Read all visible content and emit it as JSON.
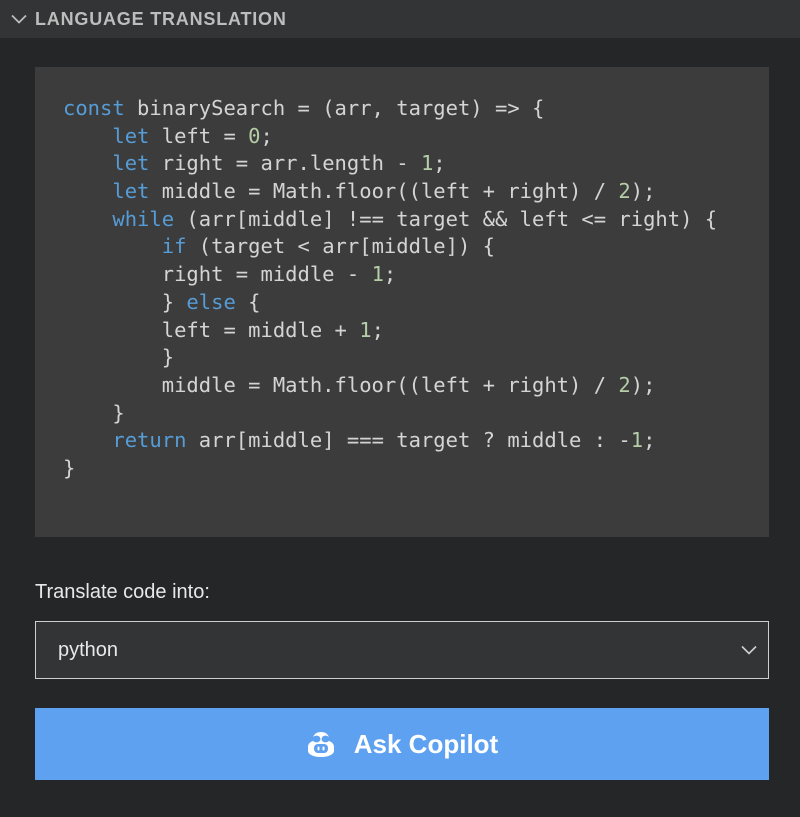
{
  "header": {
    "title": "LANGUAGE TRANSLATION",
    "icon": "chevron-down-icon"
  },
  "code": {
    "lines": [
      [
        [
          "kw",
          "const"
        ],
        [
          "p",
          " binarySearch = (arr, target) => {"
        ]
      ],
      [
        [
          "p",
          "    "
        ],
        [
          "kw",
          "let"
        ],
        [
          "p",
          " left = "
        ],
        [
          "num",
          "0"
        ],
        [
          "p",
          ";"
        ]
      ],
      [
        [
          "p",
          "    "
        ],
        [
          "kw",
          "let"
        ],
        [
          "p",
          " right = arr.length - "
        ],
        [
          "num",
          "1"
        ],
        [
          "p",
          ";"
        ]
      ],
      [
        [
          "p",
          "    "
        ],
        [
          "kw",
          "let"
        ],
        [
          "p",
          " middle = Math.floor((left + right) / "
        ],
        [
          "num",
          "2"
        ],
        [
          "p",
          ");"
        ]
      ],
      [
        [
          "p",
          "    "
        ],
        [
          "kw",
          "while"
        ],
        [
          "p",
          " (arr[middle] !== target && left <= right) {"
        ]
      ],
      [
        [
          "p",
          "        "
        ],
        [
          "kw",
          "if"
        ],
        [
          "p",
          " (target < arr[middle]) {"
        ]
      ],
      [
        [
          "p",
          "        right = middle - "
        ],
        [
          "num",
          "1"
        ],
        [
          "p",
          ";"
        ]
      ],
      [
        [
          "p",
          "        } "
        ],
        [
          "kw",
          "else"
        ],
        [
          "p",
          " {"
        ]
      ],
      [
        [
          "p",
          "        left = middle + "
        ],
        [
          "num",
          "1"
        ],
        [
          "p",
          ";"
        ]
      ],
      [
        [
          "p",
          "        }"
        ]
      ],
      [
        [
          "p",
          "        middle = Math.floor((left + right) / "
        ],
        [
          "num",
          "2"
        ],
        [
          "p",
          ");"
        ]
      ],
      [
        [
          "p",
          "    }"
        ]
      ],
      [
        [
          "p",
          "    "
        ],
        [
          "kw",
          "return"
        ],
        [
          "p",
          " arr[middle] === target ? middle : -"
        ],
        [
          "num",
          "1"
        ],
        [
          "p",
          ";"
        ]
      ],
      [
        [
          "p",
          "}"
        ]
      ]
    ],
    "colors": {
      "keyword": "#569cd6",
      "number": "#b5cea8",
      "plain": "#d4d4d4"
    }
  },
  "translate": {
    "label": "Translate code into:",
    "selected": "python",
    "icon": "chevron-down-icon"
  },
  "button": {
    "label": "Ask Copilot",
    "icon": "copilot-icon",
    "color": "#5ea1f0"
  }
}
